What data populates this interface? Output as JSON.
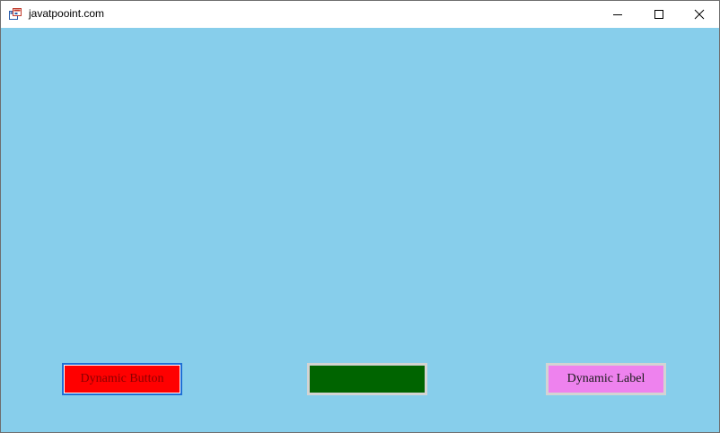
{
  "window": {
    "title": "javatpooint.com",
    "client_background": "#87ceeb"
  },
  "controls": {
    "button_label": "Dynamic Button",
    "button_color": "#ff0000",
    "button_text_color": "#8b0000",
    "textbox_value": "",
    "textbox_color": "#006400",
    "label_text": "Dynamic Label",
    "label_color": "#ee82ee"
  },
  "icons": {
    "app": "winforms-app-icon",
    "minimize": "minimize-icon",
    "maximize": "maximize-icon",
    "close": "close-icon"
  }
}
